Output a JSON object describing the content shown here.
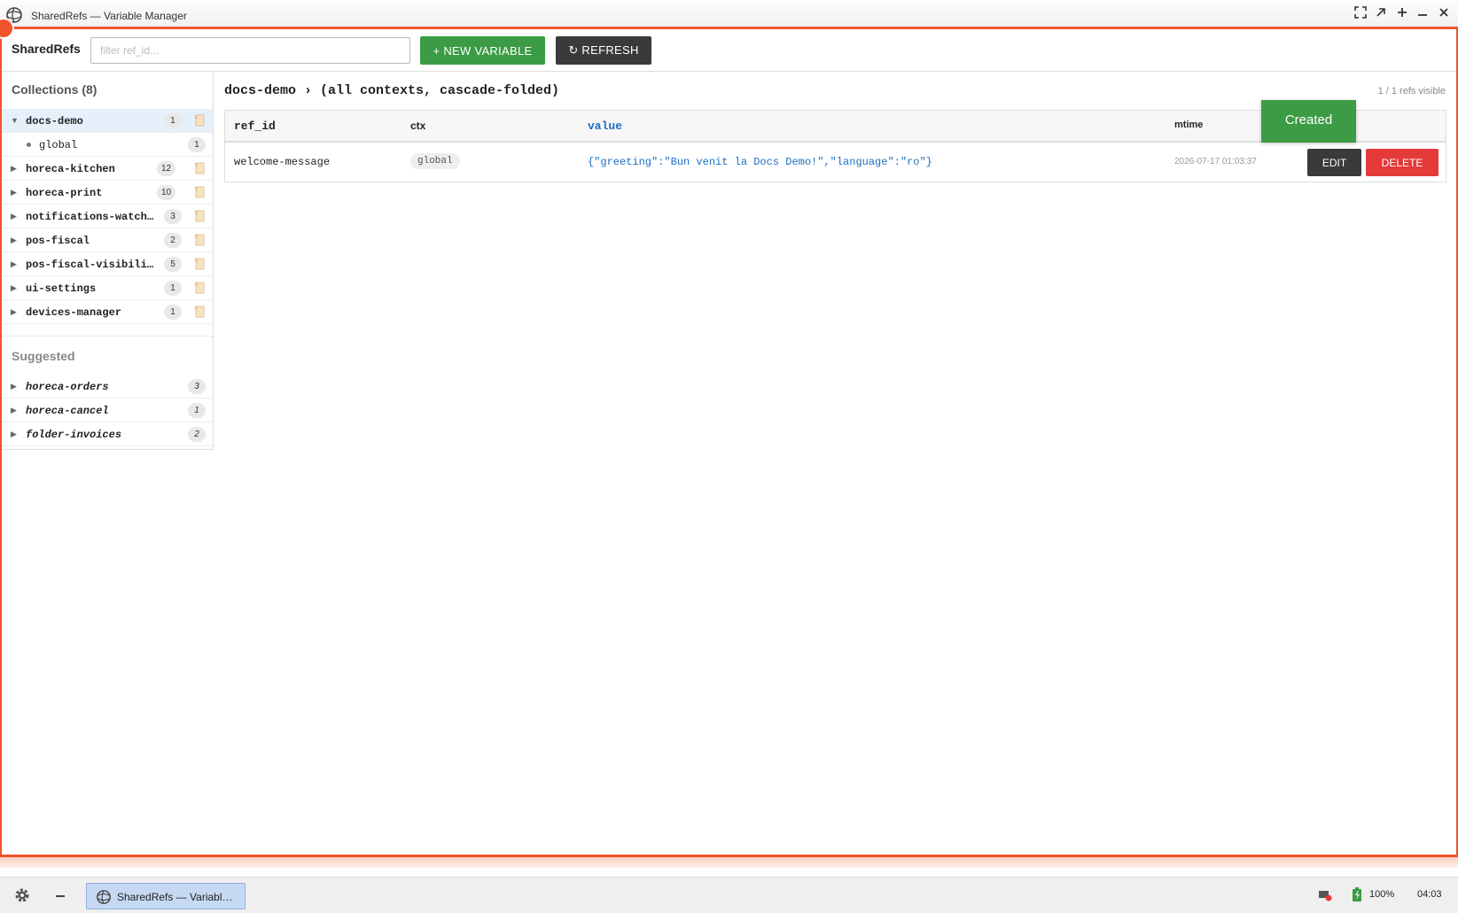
{
  "window": {
    "title": "SharedRefs — Variable Manager"
  },
  "toolbar": {
    "brand": "SharedRefs",
    "search_placeholder": "filter ref_id...",
    "search_value": "",
    "new_label": "+ NEW VARIABLE",
    "refresh_label": "↻ REFRESH"
  },
  "sidebar": {
    "collections_heading": "Collections (8)",
    "collections": [
      {
        "name": "docs-demo",
        "count": "1",
        "expanded": true
      },
      {
        "name": "horeca-kitchen",
        "count": "12"
      },
      {
        "name": "horeca-print",
        "count": "10"
      },
      {
        "name": "notifications-watch…",
        "count": "3"
      },
      {
        "name": "pos-fiscal",
        "count": "2"
      },
      {
        "name": "pos-fiscal-visibili…",
        "count": "5"
      },
      {
        "name": "ui-settings",
        "count": "1"
      },
      {
        "name": "devices-manager",
        "count": "1"
      }
    ],
    "child": {
      "name": "global",
      "count": "1"
    },
    "suggested_heading": "Suggested",
    "suggested": [
      {
        "name": "horeca-orders",
        "count": "3"
      },
      {
        "name": "horeca-cancel",
        "count": "1"
      },
      {
        "name": "folder-invoices",
        "count": "2"
      }
    ]
  },
  "main": {
    "title": "docs-demo › (all contexts, cascade-folded)",
    "refs_visible": "1 / 1 refs visible",
    "columns": {
      "ref_id": "ref_id",
      "ctx": "ctx",
      "value": "value",
      "mtime": "mtime"
    },
    "rows": [
      {
        "ref_id": "welcome-message",
        "ctx": "global",
        "value": "{\"greeting\":\"Bun venit la Docs Demo!\",\"language\":\"ro\"}",
        "mtime": "2026-07-17 01:03:37",
        "edit_label": "EDIT",
        "delete_label": "DELETE"
      }
    ]
  },
  "toast": {
    "text": "Created"
  },
  "taskbar": {
    "task_label": "SharedRefs — Variabl…",
    "battery": "100%",
    "clock": "04:03"
  },
  "colors": {
    "accent": "#f0542b",
    "primary_green": "#3c9c45",
    "danger_red": "#e53a3a",
    "dark_button": "#3a3a3a",
    "value_blue": "#1b6ec2"
  }
}
